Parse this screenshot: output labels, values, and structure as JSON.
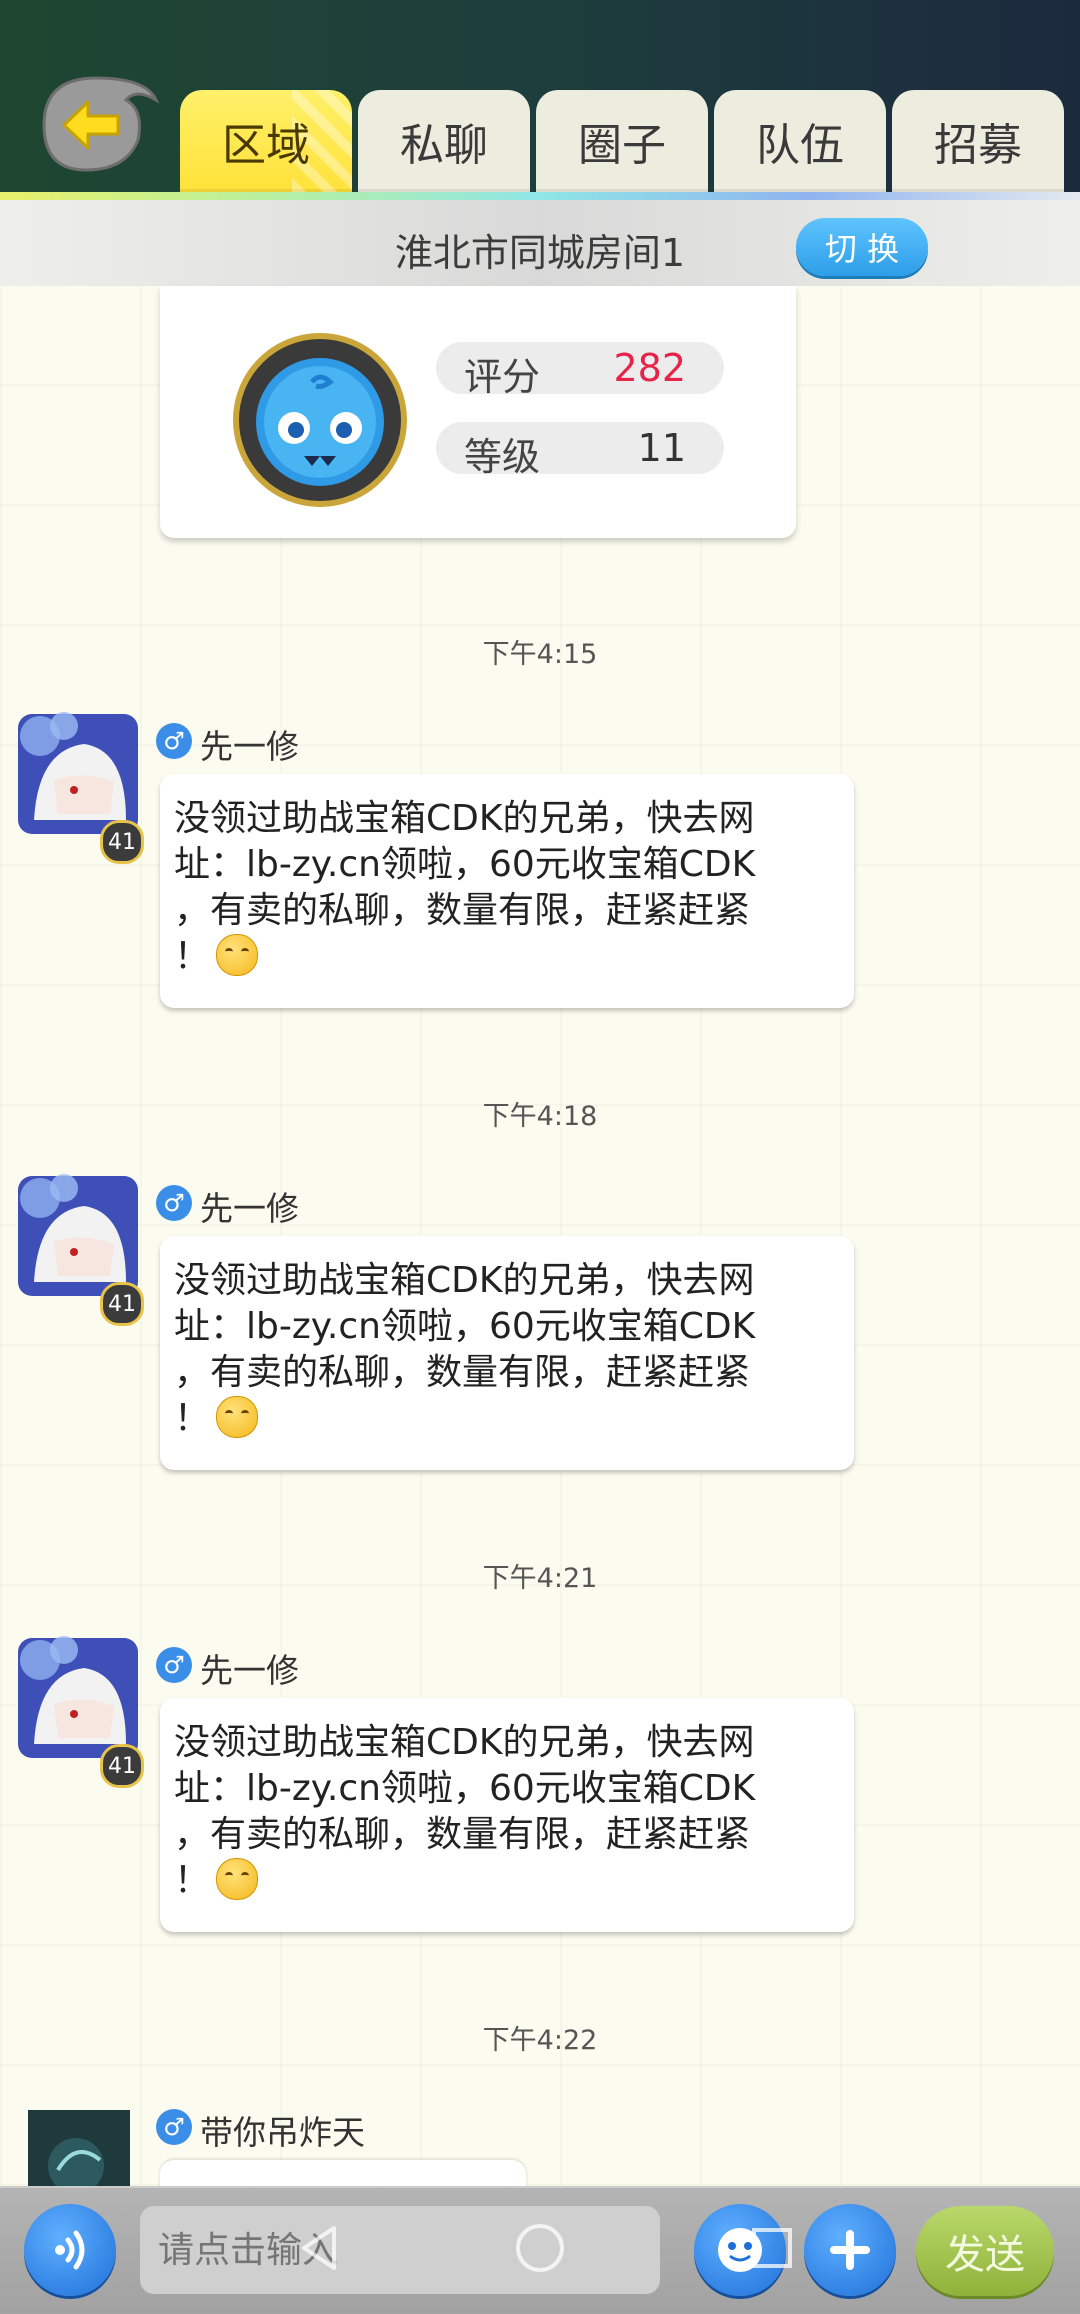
{
  "tabs": [
    {
      "label": "区域",
      "active": true
    },
    {
      "label": "私聊",
      "active": false
    },
    {
      "label": "圈子",
      "active": false
    },
    {
      "label": "队伍",
      "active": false
    },
    {
      "label": "招募",
      "active": false
    }
  ],
  "room": {
    "title": "淮北市同城房间1",
    "switch_label": "切 换"
  },
  "profile_card": {
    "score_label": "评分",
    "score_value": "282",
    "level_label": "等级",
    "level_value": "11"
  },
  "messages": [
    {
      "time": "下午4:15",
      "sender": "先一修",
      "gender": "♂",
      "level": "41",
      "text": "没领过助战宝箱CDK的兄弟，快去网\n址：lb-zy.cn领啦，60元收宝箱CDK\n，有卖的私聊，数量有限，赶紧赶紧\n！"
    },
    {
      "time": "下午4:18",
      "sender": "先一修",
      "gender": "♂",
      "level": "41",
      "text": "没领过助战宝箱CDK的兄弟，快去网\n址：lb-zy.cn领啦，60元收宝箱CDK\n，有卖的私聊，数量有限，赶紧赶紧\n！"
    },
    {
      "time": "下午4:21",
      "sender": "先一修",
      "gender": "♂",
      "level": "41",
      "text": "没领过助战宝箱CDK的兄弟，快去网\n址：lb-zy.cn领啦，60元收宝箱CDK\n，有卖的私聊，数量有限，赶紧赶紧\n！"
    }
  ],
  "last_message": {
    "time": "下午4:22",
    "sender": "带你吊炸天",
    "gender": "♂"
  },
  "input": {
    "placeholder": "请点击输入"
  },
  "send_label": "发送",
  "colors": {
    "active_tab": "#ffe23a",
    "score_value": "#e8234a",
    "switch_button": "#2d9ee8",
    "send_button": "#8fb23a"
  }
}
